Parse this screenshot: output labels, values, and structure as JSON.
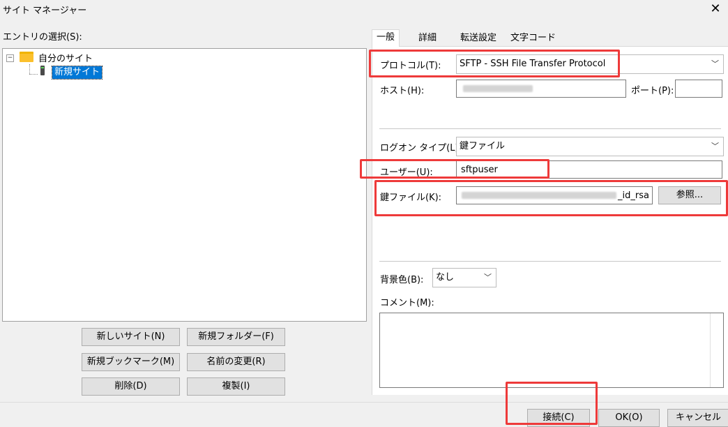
{
  "window": {
    "title": "サイト マネージャー",
    "close_glyph": "✕"
  },
  "tree": {
    "label": "エントリの選択(S):",
    "expand_glyph": "−",
    "nodes": [
      {
        "label": "自分のサイト",
        "icon": "folder-icon"
      },
      {
        "label": "新規サイト",
        "icon": "server-icon",
        "selected": true
      }
    ]
  },
  "left_buttons": {
    "new_site": "新しいサイト(N)",
    "new_folder": "新規フォルダー(F)",
    "new_bookmark": "新規ブックマーク(M)",
    "rename": "名前の変更(R)",
    "delete": "削除(D)",
    "duplicate": "複製(I)"
  },
  "tabs": [
    {
      "label": "一般",
      "active": true
    },
    {
      "label": "詳細"
    },
    {
      "label": "転送設定"
    },
    {
      "label": "文字コード"
    }
  ],
  "general": {
    "protocol_label": "プロトコル(T):",
    "protocol_value": "SFTP - SSH File Transfer Protocol",
    "host_label": "ホスト(H):",
    "port_label": "ポート(P):",
    "port_value": "",
    "logon_type_label": "ログオン タイプ(L):",
    "logon_type_value": "鍵ファイル",
    "user_label": "ユーザー(U):",
    "user_value": "sftpuser",
    "keyfile_label": "鍵ファイル(K):",
    "keyfile_value_suffix": "_id_rsa",
    "browse_button": "参照...",
    "bgcolor_label": "背景色(B):",
    "bgcolor_value": "なし",
    "comment_label": "コメント(M):",
    "dropdown_glyph": "﹀"
  },
  "footer": {
    "connect": "接続(C)",
    "ok": "OK(O)",
    "cancel": "キャンセル"
  },
  "colors": {
    "highlight_red": "#ee3a3a",
    "selection_blue": "#0078d7"
  }
}
